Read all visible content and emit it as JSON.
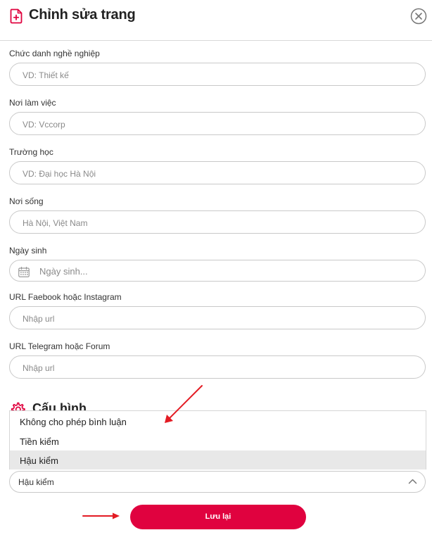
{
  "header": {
    "title": "Chỉnh sửa trang",
    "icon": "file-plus-icon",
    "close_icon": "close-circle-icon"
  },
  "fields": {
    "job_title": {
      "label": "Chức danh nghề nghiệp",
      "placeholder": "VD: Thiết kế",
      "value": ""
    },
    "workplace": {
      "label": "Nơi làm việc",
      "placeholder": "VD: Vccorp",
      "value": ""
    },
    "school": {
      "label": "Trường học",
      "placeholder": "VD: Đại học Hà Nội",
      "value": ""
    },
    "residence": {
      "label": "Nơi sống",
      "placeholder": "Hà Nội, Việt Nam",
      "value": ""
    },
    "birthday": {
      "label": "Ngày sinh",
      "placeholder": "Ngày sinh...",
      "value": ""
    },
    "facebook_url": {
      "label": "URL Faebook hoặc Instagram",
      "placeholder": "Nhập url",
      "value": ""
    },
    "telegram_url": {
      "label": "URL Telegram hoặc Forum",
      "placeholder": "Nhập url",
      "value": ""
    }
  },
  "config": {
    "section_title": "Cấu hình",
    "dropdown_options": [
      "Không cho phép bình luận",
      "Tiền kiểm",
      "Hậu kiểm"
    ],
    "selected_value": "Hậu kiểm"
  },
  "actions": {
    "save_label": "Lưu lại"
  },
  "colors": {
    "accent": "#e0023f",
    "annotation_arrow": "#e31b23"
  }
}
